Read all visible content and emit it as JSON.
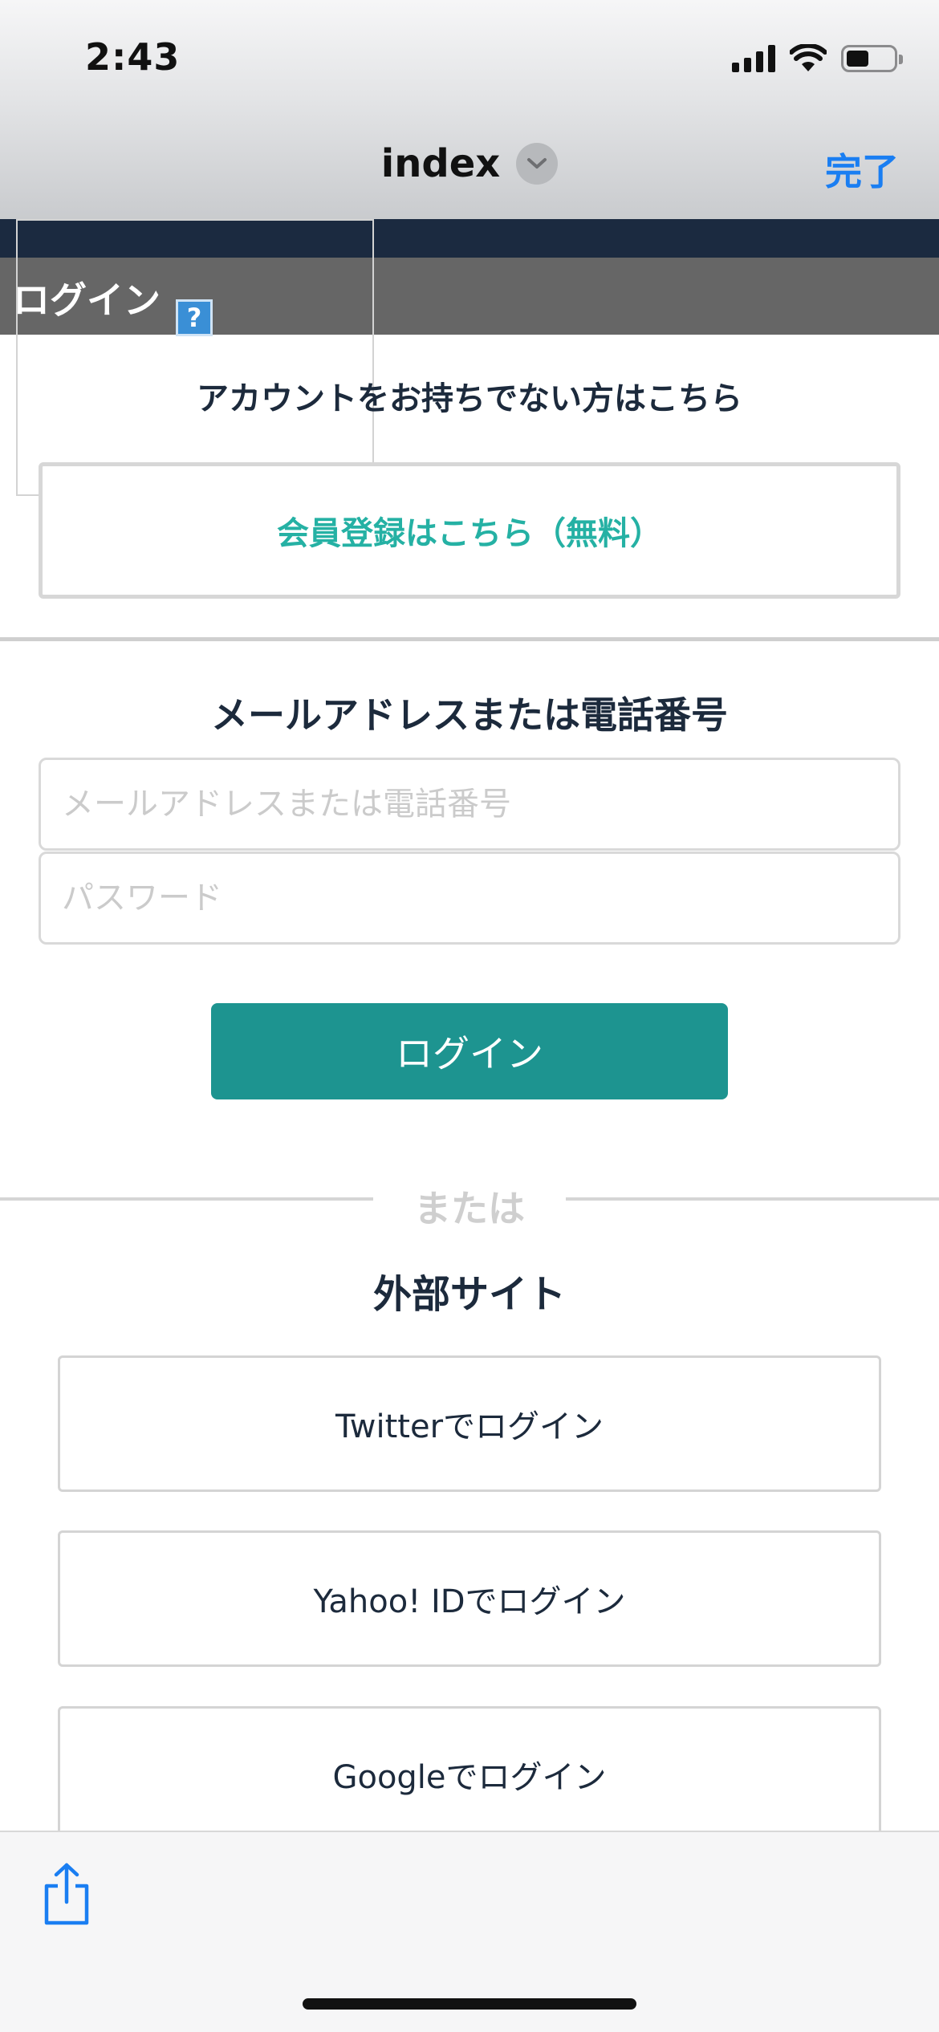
{
  "status_bar": {
    "time": "2:43",
    "icons": [
      "signal-icon",
      "wifi-icon",
      "battery-icon"
    ],
    "battery_level": 0.48
  },
  "browser_header": {
    "title": "index",
    "done_label": "完了"
  },
  "page_header": {
    "title": "ログイン",
    "help_label": "?"
  },
  "register": {
    "prompt": "アカウントをお持ちでない方はこちら",
    "button_label": "会員登録はこちら（無料）"
  },
  "login_form": {
    "heading": "メールアドレスまたは電話番号",
    "email_placeholder": "メールアドレスまたは電話番号",
    "password_placeholder": "パスワード",
    "submit_label": "ログイン"
  },
  "separator": {
    "or_label": "または"
  },
  "external": {
    "heading": "外部サイト",
    "twitter_label": "Twitterでログイン",
    "yahoo_label": "Yahoo! IDでログイン",
    "google_label": "Googleでログイン"
  },
  "colors": {
    "accent": "#1d9490",
    "link_teal": "#25b1a4",
    "ios_blue": "#1a7ef2",
    "navy": "#1b2a40"
  }
}
